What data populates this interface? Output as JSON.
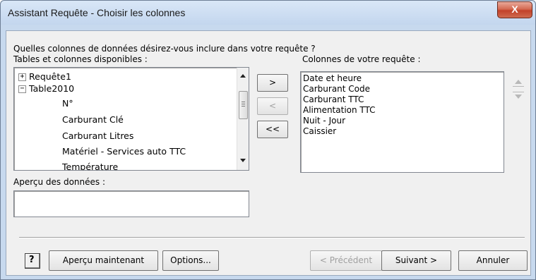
{
  "window": {
    "title": "Assistant Requête - Choisir les colonnes",
    "close_glyph": "X"
  },
  "prompt": "Quelles colonnes de données désirez-vous inclure dans votre requête ?",
  "available": {
    "label": "Tables et colonnes disponibles :",
    "tree": [
      {
        "label": "Requête1",
        "expander": "+"
      },
      {
        "label": "Table2010",
        "expander": "−"
      },
      {
        "label": "N°"
      },
      {
        "label": "Carburant Clé"
      },
      {
        "label": "Carburant Litres"
      },
      {
        "label": "Matériel - Services auto TTC"
      },
      {
        "label": "Température"
      }
    ]
  },
  "move_buttons": {
    "add": ">",
    "remove": "<",
    "remove_all": "<<"
  },
  "selected": {
    "label": "Colonnes de votre requête :",
    "items": [
      "Date et heure",
      "Carburant Code",
      "Carburant TTC",
      "Alimentation TTC",
      "Nuit - Jour",
      "Caissier"
    ]
  },
  "preview": {
    "label": "Aperçu des données :",
    "value": ""
  },
  "footer": {
    "help": "?",
    "preview_now": "Aperçu maintenant",
    "options": "Options...",
    "previous": "< Précédent",
    "next": "Suivant >",
    "cancel": "Annuler"
  }
}
